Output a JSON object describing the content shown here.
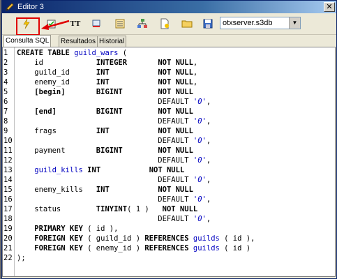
{
  "window": {
    "title": "Editor 3"
  },
  "toolbar": {
    "database": "otxserver.s3db",
    "buttons": [
      {
        "name": "execute",
        "icon": "lightning-icon"
      },
      {
        "name": "check",
        "icon": "checklist-icon"
      },
      {
        "name": "format",
        "icon": "text-size-icon",
        "label": "TT"
      },
      {
        "name": "clear",
        "icon": "eraser-icon"
      },
      {
        "name": "history",
        "icon": "list-icon"
      },
      {
        "name": "schema",
        "icon": "tree-icon"
      },
      {
        "name": "new",
        "icon": "new-file-icon"
      },
      {
        "name": "open",
        "icon": "folder-icon"
      },
      {
        "name": "save",
        "icon": "floppy-icon"
      }
    ]
  },
  "tabs": [
    "Consulta SQL",
    "Resultados",
    "Historial"
  ],
  "gutter": [
    "1",
    "2",
    "3",
    "4",
    "5",
    "6",
    "7",
    "8",
    "9",
    "10",
    "11",
    "12",
    "13",
    "14",
    "15",
    "16",
    "17",
    "18",
    "19",
    "20",
    "21",
    "22"
  ],
  "code": [
    {
      "parts": [
        [
          "kw",
          "CREATE TABLE "
        ],
        [
          "id",
          "guild_wars"
        ],
        [
          "",
          " ("
        ]
      ]
    },
    {
      "parts": [
        [
          "",
          "    id            "
        ],
        [
          "kw",
          "INTEGER"
        ],
        [
          "",
          "       "
        ],
        [
          "kw",
          "NOT NULL"
        ],
        [
          "",
          ","
        ]
      ]
    },
    {
      "parts": [
        [
          "",
          "    guild_id      "
        ],
        [
          "kw",
          "INT"
        ],
        [
          "",
          "           "
        ],
        [
          "kw",
          "NOT NULL"
        ],
        [
          "",
          ","
        ]
      ]
    },
    {
      "parts": [
        [
          "",
          "    enemy_id      "
        ],
        [
          "kw",
          "INT"
        ],
        [
          "",
          "           "
        ],
        [
          "kw",
          "NOT NULL"
        ],
        [
          "",
          ","
        ]
      ]
    },
    {
      "parts": [
        [
          "",
          "    "
        ],
        [
          "kw",
          "[begin]"
        ],
        [
          "",
          "       "
        ],
        [
          "kw",
          "BIGINT"
        ],
        [
          "",
          "        "
        ],
        [
          "kw",
          "NOT NULL"
        ]
      ]
    },
    {
      "parts": [
        [
          "",
          "                                DEFAULT "
        ],
        [
          "str",
          "'0'"
        ],
        [
          "",
          ","
        ]
      ]
    },
    {
      "parts": [
        [
          "",
          "    "
        ],
        [
          "kw",
          "[end]"
        ],
        [
          "",
          "         "
        ],
        [
          "kw",
          "BIGINT"
        ],
        [
          "",
          "        "
        ],
        [
          "kw",
          "NOT NULL"
        ]
      ]
    },
    {
      "parts": [
        [
          "",
          "                                DEFAULT "
        ],
        [
          "str",
          "'0'"
        ],
        [
          "",
          ","
        ]
      ]
    },
    {
      "parts": [
        [
          "",
          "    frags         "
        ],
        [
          "kw",
          "INT"
        ],
        [
          "",
          "           "
        ],
        [
          "kw",
          "NOT NULL"
        ]
      ]
    },
    {
      "parts": [
        [
          "",
          "                                DEFAULT "
        ],
        [
          "str",
          "'0'"
        ],
        [
          "",
          ","
        ]
      ]
    },
    {
      "parts": [
        [
          "",
          "    payment       "
        ],
        [
          "kw",
          "BIGINT"
        ],
        [
          "",
          "        "
        ],
        [
          "kw",
          "NOT NULL"
        ]
      ]
    },
    {
      "parts": [
        [
          "",
          "                                DEFAULT "
        ],
        [
          "str",
          "'0'"
        ],
        [
          "",
          ","
        ]
      ]
    },
    {
      "parts": [
        [
          "",
          "    "
        ],
        [
          "id",
          "guild_kills"
        ],
        [
          "",
          " "
        ],
        [
          "kw",
          "INT"
        ],
        [
          "",
          "           "
        ],
        [
          "kw",
          "NOT NULL"
        ]
      ]
    },
    {
      "parts": [
        [
          "",
          "                                DEFAULT "
        ],
        [
          "str",
          "'0'"
        ],
        [
          "",
          ","
        ]
      ]
    },
    {
      "parts": [
        [
          "",
          "    enemy_kills   "
        ],
        [
          "kw",
          "INT"
        ],
        [
          "",
          "           "
        ],
        [
          "kw",
          "NOT NULL"
        ]
      ]
    },
    {
      "parts": [
        [
          "",
          "                                DEFAULT "
        ],
        [
          "str",
          "'0'"
        ],
        [
          "",
          ","
        ]
      ]
    },
    {
      "parts": [
        [
          "",
          "    status        "
        ],
        [
          "kw",
          "TINYINT"
        ],
        [
          "",
          "( 1 )   "
        ],
        [
          "kw",
          "NOT NULL"
        ]
      ]
    },
    {
      "parts": [
        [
          "",
          "                                DEFAULT "
        ],
        [
          "str",
          "'0'"
        ],
        [
          "",
          ","
        ]
      ]
    },
    {
      "parts": [
        [
          "",
          "    "
        ],
        [
          "kw",
          "PRIMARY KEY"
        ],
        [
          "",
          " ( id ),"
        ]
      ]
    },
    {
      "parts": [
        [
          "",
          "    "
        ],
        [
          "kw",
          "FOREIGN KEY"
        ],
        [
          "",
          " ( guild_id ) "
        ],
        [
          "kw",
          "REFERENCES"
        ],
        [
          "",
          " "
        ],
        [
          "id",
          "guilds"
        ],
        [
          "",
          " ( id ),"
        ]
      ]
    },
    {
      "parts": [
        [
          "",
          "    "
        ],
        [
          "kw",
          "FOREIGN KEY"
        ],
        [
          "",
          " ( enemy_id ) "
        ],
        [
          "kw",
          "REFERENCES"
        ],
        [
          "",
          " "
        ],
        [
          "id",
          "guilds"
        ],
        [
          "",
          " ( id )"
        ]
      ]
    },
    {
      "parts": [
        [
          "",
          ");"
        ]
      ]
    }
  ]
}
